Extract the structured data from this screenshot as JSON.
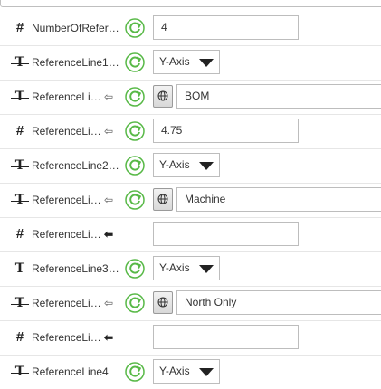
{
  "colors": {
    "refresh_green": "#58b947",
    "border": "#bdbdbd",
    "row_divider": "#e6e6e6"
  },
  "icons": {
    "number_type": "#",
    "text_type": "T",
    "arrow_outline": "⇦",
    "arrow_solid": "⬅"
  },
  "rows": [
    {
      "kind": "number",
      "label": "NumberOfRefer…",
      "value": "4"
    },
    {
      "kind": "text",
      "label": "ReferenceLine1…",
      "select": "Y-Axis"
    },
    {
      "kind": "text",
      "label": "ReferenceLi…",
      "arrow": "outline",
      "value": "BOM"
    },
    {
      "kind": "number",
      "label": "ReferenceLi…",
      "arrow": "outline",
      "value": "4.75"
    },
    {
      "kind": "text",
      "label": "ReferenceLine2…",
      "select": "Y-Axis"
    },
    {
      "kind": "text",
      "label": "ReferenceLi…",
      "arrow": "outline",
      "value": "Machine"
    },
    {
      "kind": "number",
      "label": "ReferenceLi…",
      "arrow": "solid",
      "value": ""
    },
    {
      "kind": "text",
      "label": "ReferenceLine3…",
      "select": "Y-Axis"
    },
    {
      "kind": "text",
      "label": "ReferenceLi…",
      "arrow": "outline",
      "value": "North Only"
    },
    {
      "kind": "number",
      "label": "ReferenceLi…",
      "arrow": "solid",
      "value": ""
    },
    {
      "kind": "text",
      "label": "ReferenceLine4",
      "select": "Y-Axis"
    }
  ]
}
